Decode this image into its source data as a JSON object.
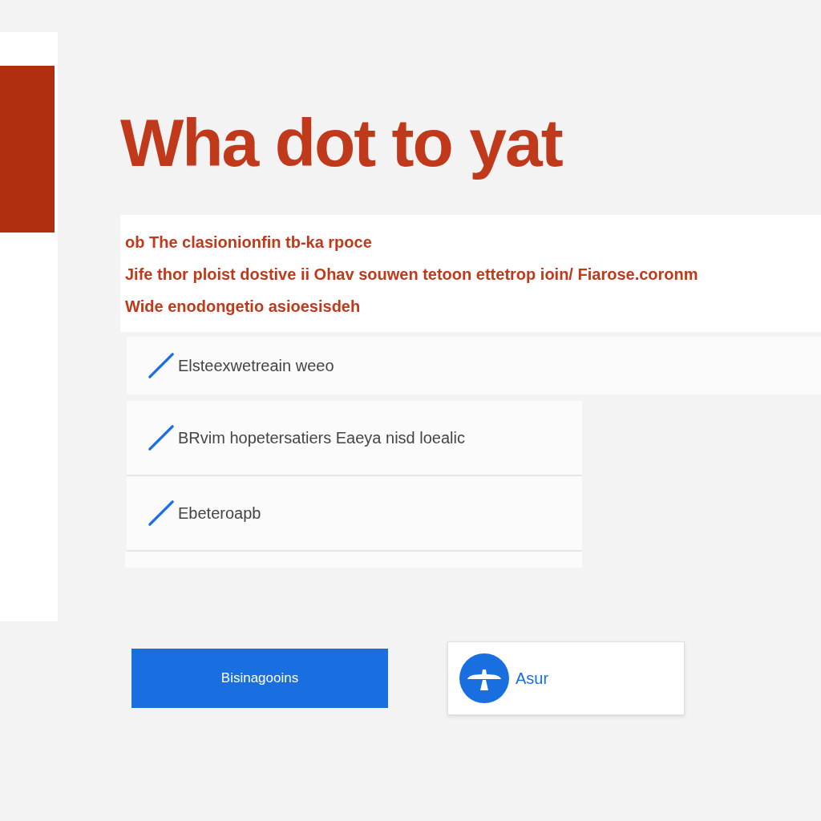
{
  "heading": "Wha dot to yat",
  "notice": {
    "lines": [
      "ob The clasionionfin tb-ka rpoce",
      "Jife thor ploist dostive ii Ohav souwen tetoon ettetrop ioin/ Fiarose.coronm",
      "Wide enodongetio asioesisdeh"
    ]
  },
  "options": [
    {
      "label": "Elsteexwetreain weeo",
      "checked": true
    },
    {
      "label": "BRvim hopetersatiers Eaeya nisd loealic",
      "checked": true
    },
    {
      "label": "Ebeteroapb",
      "checked": true
    }
  ],
  "primary_button": "Bisinagooins",
  "secondary_button": "Asur"
}
